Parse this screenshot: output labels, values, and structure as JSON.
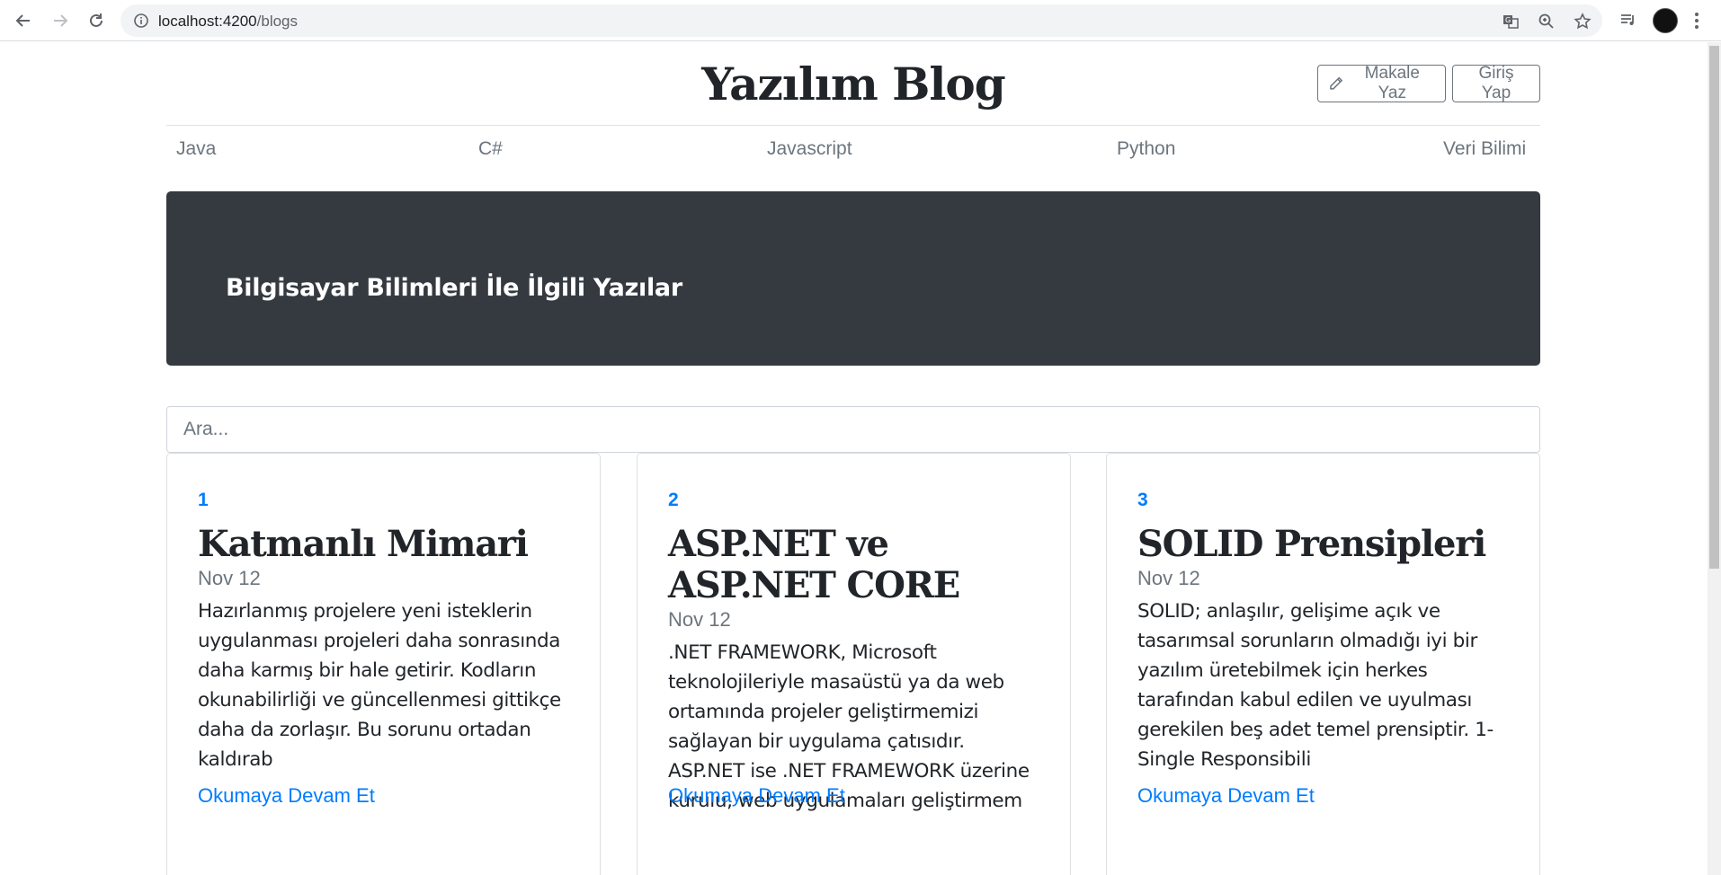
{
  "browser": {
    "url_host": "localhost:4200",
    "url_path": "/blogs"
  },
  "header": {
    "title": "Yazılım Blog",
    "write_label": "Makale Yaz",
    "login_label": "Giriş Yap"
  },
  "categories": [
    "Java",
    "C#",
    "Javascript",
    "Python",
    "Veri Bilimi"
  ],
  "jumbotron": {
    "text": "Bilgisayar Bilimleri İle İlgili Yazılar"
  },
  "search": {
    "placeholder": "Ara..."
  },
  "posts": [
    {
      "number": "1",
      "title": "Katmanlı Mimari",
      "date": "Nov 12",
      "excerpt": "Hazırlanmış projelere yeni isteklerin uygulanması projeleri daha sonrasında daha karmış bir hale getirir. Kodların okunabilirliği ve güncellenmesi gittikçe daha da zorlaşır. Bu sorunu ortadan kaldırab",
      "link": "Okumaya Devam Et"
    },
    {
      "number": "2",
      "title": "ASP.NET ve ASP.NET CORE",
      "date": "Nov 12",
      "excerpt": ".NET FRAMEWORK, Microsoft teknolojileriyle masaüstü ya da web ortamında projeler geliştirmemizi sağlayan bir uygulama çatısıdır. ASP.NET ise .NET FRAMEWORK üzerine kurulu, web uygulamaları geliştirmem",
      "link": "Okumaya Devam Et"
    },
    {
      "number": "3",
      "title": "SOLID Prensipleri",
      "date": "Nov 12",
      "excerpt": "SOLID; anlaşılır, gelişime açık ve tasarımsal sorunların olmadığı iyi bir yazılım üretebilmek için herkes tarafından kabul edilen ve uyulması gerekilen beş adet temel prensiptir. 1-Single Responsibili",
      "link": "Okumaya Devam Et"
    }
  ],
  "colors": {
    "primary": "#007bff",
    "dark": "#343a40",
    "muted": "#6c757d"
  },
  "icons": [
    "back-arrow-icon",
    "forward-arrow-icon",
    "reload-icon",
    "info-icon",
    "translate-icon",
    "zoom-icon",
    "star-icon",
    "media-icon",
    "pencil-icon",
    "menu-dots-icon"
  ]
}
